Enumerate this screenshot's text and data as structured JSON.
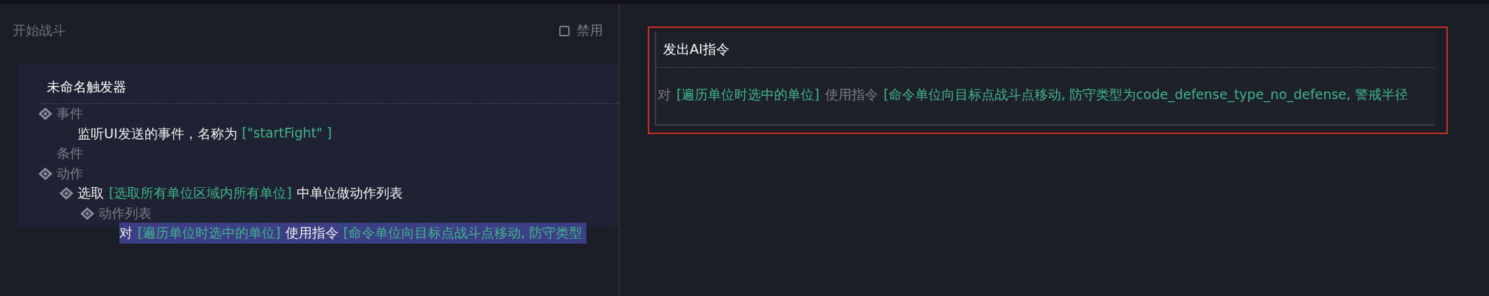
{
  "left_panel": {
    "title": "开始战斗",
    "disable_checkbox": {
      "label": "禁用",
      "checked": false
    },
    "trigger": {
      "title": "未命名触发器",
      "tree": [
        {
          "toggle": true,
          "selected": false,
          "parts": [
            {
              "kind": "label",
              "text": "事件"
            }
          ],
          "children": [
            {
              "toggle": false,
              "selected": false,
              "parts": [
                {
                  "kind": "text",
                  "text": "监听UI发送的事件，名称为"
                },
                {
                  "kind": "param",
                  "text": "[\"startFight\" ]"
                }
              ]
            }
          ]
        },
        {
          "toggle": false,
          "selected": false,
          "parts": [
            {
              "kind": "label",
              "text": "条件"
            }
          ]
        },
        {
          "toggle": true,
          "selected": false,
          "parts": [
            {
              "kind": "label",
              "text": "动作"
            }
          ],
          "children": [
            {
              "toggle": true,
              "selected": false,
              "parts": [
                {
                  "kind": "text",
                  "text": "选取"
                },
                {
                  "kind": "param",
                  "text": "[选取所有单位区域内所有单位]"
                },
                {
                  "kind": "text",
                  "text": "中单位做动作列表"
                }
              ],
              "children": [
                {
                  "toggle": true,
                  "selected": false,
                  "parts": [
                    {
                      "kind": "label",
                      "text": "动作列表"
                    }
                  ],
                  "children": [
                    {
                      "toggle": false,
                      "selected": true,
                      "parts": [
                        {
                          "kind": "text",
                          "text": "对"
                        },
                        {
                          "kind": "param",
                          "text": "[遍历单位时选中的单位]"
                        },
                        {
                          "kind": "text",
                          "text": "使用指令"
                        },
                        {
                          "kind": "param",
                          "text": "[命令单位向目标点战斗点移动, 防守类型"
                        }
                      ]
                    }
                  ]
                }
              ]
            }
          ]
        }
      ]
    }
  },
  "right_panel": {
    "card": {
      "title": "发出AI指令",
      "selected": true,
      "parts": [
        {
          "kind": "label",
          "text": "对"
        },
        {
          "kind": "param",
          "text": "[遍历单位时选中的单位]"
        },
        {
          "kind": "label",
          "text": "使用指令"
        },
        {
          "kind": "param",
          "text": "[命令单位向目标点战斗点移动, 防守类型为code_defense_type_no_defense, 警戒半径"
        }
      ]
    }
  }
}
